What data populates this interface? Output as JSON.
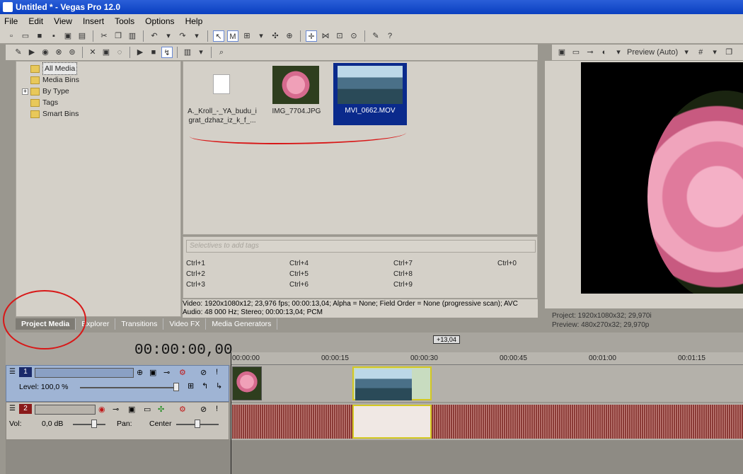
{
  "window": {
    "title": "Untitled * - Vegas Pro 12.0"
  },
  "menu": [
    "File",
    "Edit",
    "View",
    "Insert",
    "Tools",
    "Options",
    "Help"
  ],
  "tree": {
    "items": [
      "All Media",
      "Media Bins",
      "By Type",
      "Tags",
      "Smart Bins"
    ],
    "expand_glyph": "+"
  },
  "media": {
    "items": [
      {
        "caption_line1": "A._Kroll_-_YA_budu_i",
        "caption_line2": "grat_dzhaz_iz_k_f_..."
      },
      {
        "caption_line1": "IMG_7704.JPG",
        "caption_line2": ""
      },
      {
        "caption_line1": "MVI_0662.MOV",
        "caption_line2": ""
      }
    ]
  },
  "selectives": {
    "placeholder": "Selectives to add tags",
    "shortcuts": [
      "Ctrl+1",
      "Ctrl+2",
      "Ctrl+3",
      "Ctrl+4",
      "Ctrl+5",
      "Ctrl+6",
      "Ctrl+7",
      "Ctrl+8",
      "Ctrl+9",
      "Ctrl+0"
    ]
  },
  "info": {
    "video": "Video: 1920x1080x12; 23,976 fps; 00:00:13,04; Alpha = None; Field Order = None (progressive scan); AVC",
    "audio": "Audio: 48 000 Hz; Stereo; 00:00:13,04; PCM"
  },
  "tabs": [
    "Project Media",
    "Explorer",
    "Transitions",
    "Video FX",
    "Media Generators"
  ],
  "preview": {
    "mode_label": "Preview (Auto)",
    "project": "Project:  1920x1080x32; 29,970i",
    "preview": "Preview:  480x270x32; 29,970p"
  },
  "timeline": {
    "timecode": "00:00:00,00",
    "selection_length": "+13,04",
    "ruler": [
      "00:00:00",
      "00:00:15",
      "00:00:30",
      "00:00:45",
      "00:01:00",
      "00:01:15"
    ],
    "video_track": {
      "number": "1",
      "level_label": "Level: 100,0 %"
    },
    "audio_track": {
      "number": "2",
      "vol_label": "Vol:",
      "vol_value": "0,0 dB",
      "pan_label": "Pan:",
      "pan_value": "Center"
    }
  }
}
